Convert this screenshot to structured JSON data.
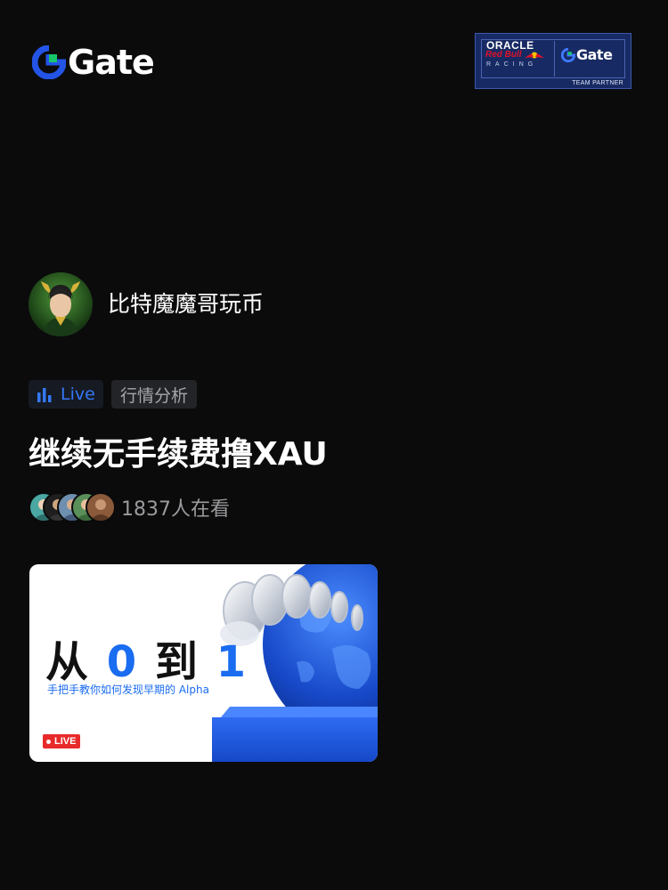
{
  "brand": {
    "name": "Gate",
    "accent": "#2354e6",
    "logo_green": "#18c66b"
  },
  "partner": {
    "oracle": "ORACLE",
    "redbull": "Red Bull",
    "racing": "RACING",
    "gate": "Gate",
    "team_partner": "TEAM PARTNER"
  },
  "streamer": {
    "name": "比特魔魔哥玩币",
    "avatar_icon": "avatar-icon"
  },
  "tags": {
    "live_label": "Live",
    "live_icon": "bar-chart-icon",
    "category": "行情分析"
  },
  "stream": {
    "title": "继续无手续费撸XAU",
    "viewers_text": "1837人在看"
  },
  "cover": {
    "headline_part1": "从",
    "headline_num1": "0",
    "headline_part2": "到",
    "headline_num2": "1",
    "subtitle": "手把手教你如何发现早期的 Alpha",
    "live_badge": "LIVE"
  },
  "colors": {
    "background": "#0b0b0c",
    "live_blue": "#3478f6",
    "badge_red": "#e82a2a"
  }
}
